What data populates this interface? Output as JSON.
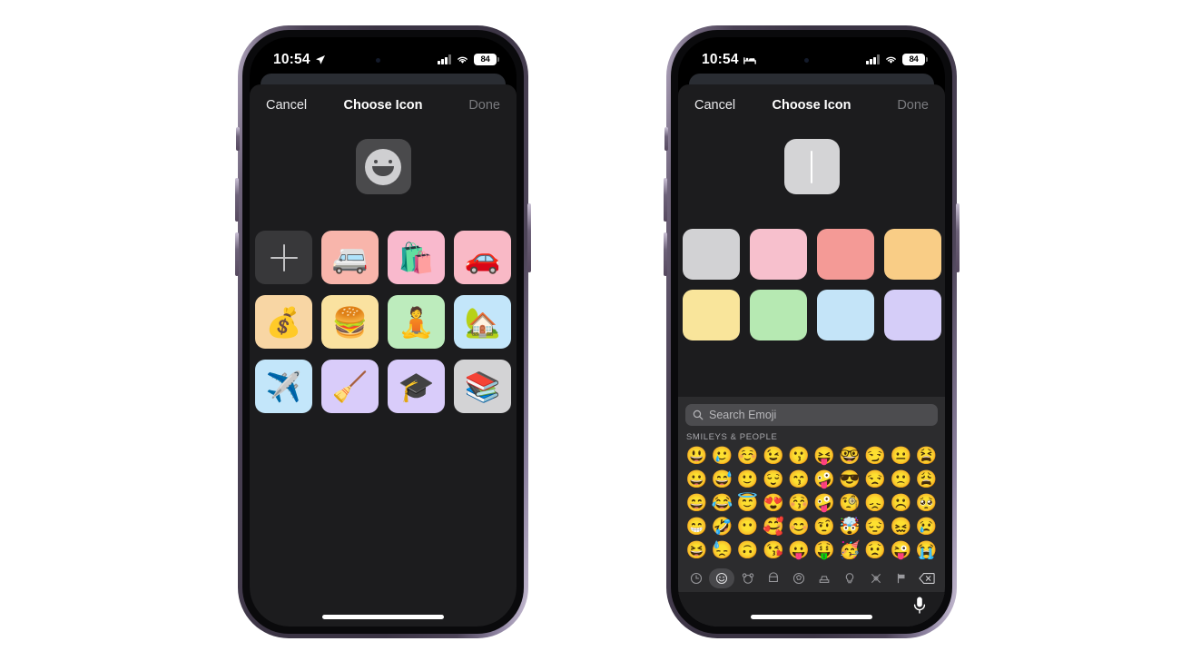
{
  "phones": [
    {
      "id": "left",
      "status_bar": {
        "time": "10:54",
        "time_icon": "location-arrow-icon",
        "battery_level": "84",
        "signal_icon": "cellular-signal-icon",
        "wifi_icon": "wifi-icon"
      },
      "sheet": {
        "cancel_label": "Cancel",
        "title": "Choose Icon",
        "done_label": "Done"
      },
      "preview": {
        "mode": "emoji-placeholder",
        "glyph": "smiley-outline-icon"
      },
      "icon_grid": [
        {
          "name": "add-icon-button",
          "type": "add",
          "glyph": "plus-icon",
          "bg": "#38383a"
        },
        {
          "name": "icon-minibus",
          "type": "emoji",
          "glyph": "🚐",
          "bg": "#f8b5ab"
        },
        {
          "name": "icon-shopping-bags",
          "type": "emoji",
          "glyph": "🛍️",
          "bg": "#f9b9cd"
        },
        {
          "name": "icon-red-car",
          "type": "emoji",
          "glyph": "🚗",
          "bg": "#f9b9c6"
        },
        {
          "name": "icon-money-bag",
          "type": "emoji",
          "glyph": "💰",
          "bg": "#f8d6a4"
        },
        {
          "name": "icon-hamburger",
          "type": "emoji",
          "glyph": "🍔",
          "bg": "#fae2a0"
        },
        {
          "name": "icon-lotus-position",
          "type": "emoji",
          "glyph": "🧘",
          "bg": "#bdecbd"
        },
        {
          "name": "icon-house",
          "type": "emoji",
          "glyph": "🏡",
          "bg": "#c3e6fa"
        },
        {
          "name": "icon-airplane",
          "type": "emoji",
          "glyph": "✈️",
          "bg": "#c3e6fa"
        },
        {
          "name": "icon-broom",
          "type": "emoji",
          "glyph": "🧹",
          "bg": "#d9ccfa"
        },
        {
          "name": "icon-graduation-cap",
          "type": "emoji",
          "glyph": "🎓",
          "bg": "#d9ccfa"
        },
        {
          "name": "icon-books",
          "type": "emoji",
          "glyph": "📚",
          "bg": "#d3d3d5"
        }
      ]
    },
    {
      "id": "right",
      "status_bar": {
        "time": "10:54",
        "time_icon": "bed-sleep-focus-icon",
        "battery_level": "84",
        "signal_icon": "cellular-signal-icon",
        "wifi_icon": "wifi-icon"
      },
      "sheet": {
        "cancel_label": "Cancel",
        "title": "Choose Icon",
        "done_label": "Done"
      },
      "preview": {
        "mode": "text-cursor",
        "glyph": "text-caret-icon",
        "bg": "#d4d4d6"
      },
      "swatches": [
        {
          "name": "swatch-gray",
          "color": "#d2d2d4"
        },
        {
          "name": "swatch-pink",
          "color": "#f7c0cd"
        },
        {
          "name": "swatch-salmon",
          "color": "#f49a96"
        },
        {
          "name": "swatch-orange",
          "color": "#f9cd86"
        },
        {
          "name": "swatch-yellow",
          "color": "#f9e59b"
        },
        {
          "name": "swatch-green",
          "color": "#b6e9b2"
        },
        {
          "name": "swatch-light-blue",
          "color": "#c4e4f8"
        },
        {
          "name": "swatch-lavender",
          "color": "#d5cdf8"
        }
      ],
      "keyboard": {
        "search_placeholder": "Search Emoji",
        "search_icon": "search-icon",
        "section_title": "SMILEYS & PEOPLE",
        "emoji_rows": [
          [
            "😃",
            "🥲",
            "☺️",
            "😉",
            "😗",
            "😝",
            "🤓",
            "😏",
            "😐",
            "😫"
          ],
          [
            "😀",
            "😅",
            "🙂",
            "😌",
            "😙",
            "🤪",
            "😎",
            "😒",
            "🙁",
            "😩"
          ],
          [
            "😄",
            "😂",
            "😇",
            "😍",
            "😚",
            "🤪",
            "🧐",
            "😞",
            "☹️",
            "🥺"
          ],
          [
            "😁",
            "🤣",
            "😶",
            "🥰",
            "😊",
            "🤨",
            "🤯",
            "😔",
            "😖",
            "😢"
          ],
          [
            "😆",
            "😓",
            "🙃",
            "😘",
            "😛",
            "🤑",
            "🥳",
            "😟",
            "😜",
            "😭"
          ]
        ],
        "categories": [
          {
            "name": "category-recents-icon",
            "selected": false
          },
          {
            "name": "category-smileys-icon",
            "selected": true
          },
          {
            "name": "category-animals-icon",
            "selected": false
          },
          {
            "name": "category-food-icon",
            "selected": false
          },
          {
            "name": "category-activity-icon",
            "selected": false
          },
          {
            "name": "category-travel-icon",
            "selected": false
          },
          {
            "name": "category-objects-icon",
            "selected": false
          },
          {
            "name": "category-symbols-icon",
            "selected": false
          },
          {
            "name": "category-flags-icon",
            "selected": false
          }
        ],
        "delete_key": "delete-backspace-icon",
        "dictation_key": "microphone-icon"
      }
    }
  ],
  "colors": {
    "page_background": "#ffffff",
    "sheet_background": "#1c1c1e",
    "keyboard_background": "#2c2c2e",
    "accent_disabled": "#797a7e"
  }
}
